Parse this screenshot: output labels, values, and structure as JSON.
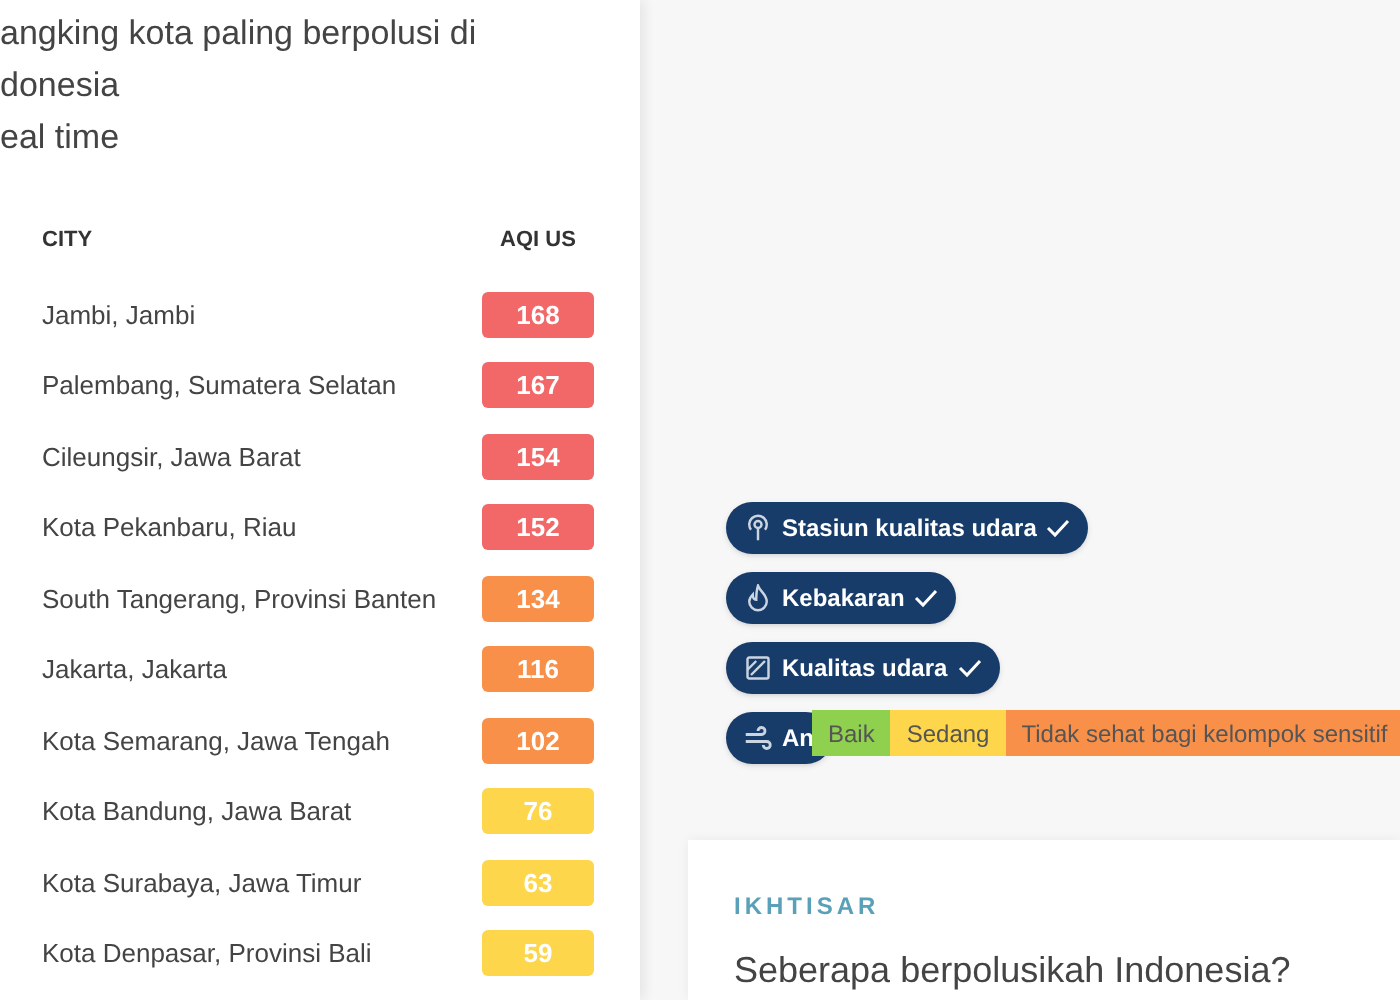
{
  "title_lines": [
    "angking kota paling berpolusi di",
    "donesia",
    "eal time"
  ],
  "table": {
    "columns": [
      "CITY",
      "AQI US"
    ],
    "rows": [
      {
        "city": "Jambi, Jambi",
        "aqi": "168",
        "color": "#f26767"
      },
      {
        "city": "Palembang, Sumatera Selatan",
        "aqi": "167",
        "color": "#f26767"
      },
      {
        "city": "Cileungsir, Jawa Barat",
        "aqi": "154",
        "color": "#f26767"
      },
      {
        "city": "Kota Pekanbaru, Riau",
        "aqi": "152",
        "color": "#f26767"
      },
      {
        "city": "South Tangerang, Provinsi Banten",
        "aqi": "134",
        "color": "#f99049"
      },
      {
        "city": "Jakarta, Jakarta",
        "aqi": "116",
        "color": "#f99049"
      },
      {
        "city": "Kota Semarang, Jawa Tengah",
        "aqi": "102",
        "color": "#f99049"
      },
      {
        "city": "Kota Bandung, Jawa Barat",
        "aqi": "76",
        "color": "#fdd64b"
      },
      {
        "city": "Kota Surabaya, Jawa Timur",
        "aqi": "63",
        "color": "#fdd64b"
      },
      {
        "city": "Kota Denpasar, Provinsi Bali",
        "aqi": "59",
        "color": "#fdd64b"
      }
    ]
  },
  "layers": [
    {
      "kind": "station",
      "label": "Stasiun kualitas udara",
      "checked": true
    },
    {
      "kind": "fire",
      "label": "Kebakaran",
      "checked": true
    },
    {
      "kind": "air",
      "label": "Kualitas udara",
      "checked": true
    },
    {
      "kind": "wind",
      "label": "An",
      "checked": false
    }
  ],
  "legend": [
    {
      "label": "Baik",
      "color": "#8fd14f"
    },
    {
      "label": "Sedang",
      "color": "#fdd64b"
    },
    {
      "label": "Tidak sehat bagi kelompok sensitif",
      "color": "#f99049"
    }
  ],
  "overview": {
    "eyebrow": "IKHTISAR",
    "heading": "Seberapa berpolusikah Indonesia?"
  }
}
